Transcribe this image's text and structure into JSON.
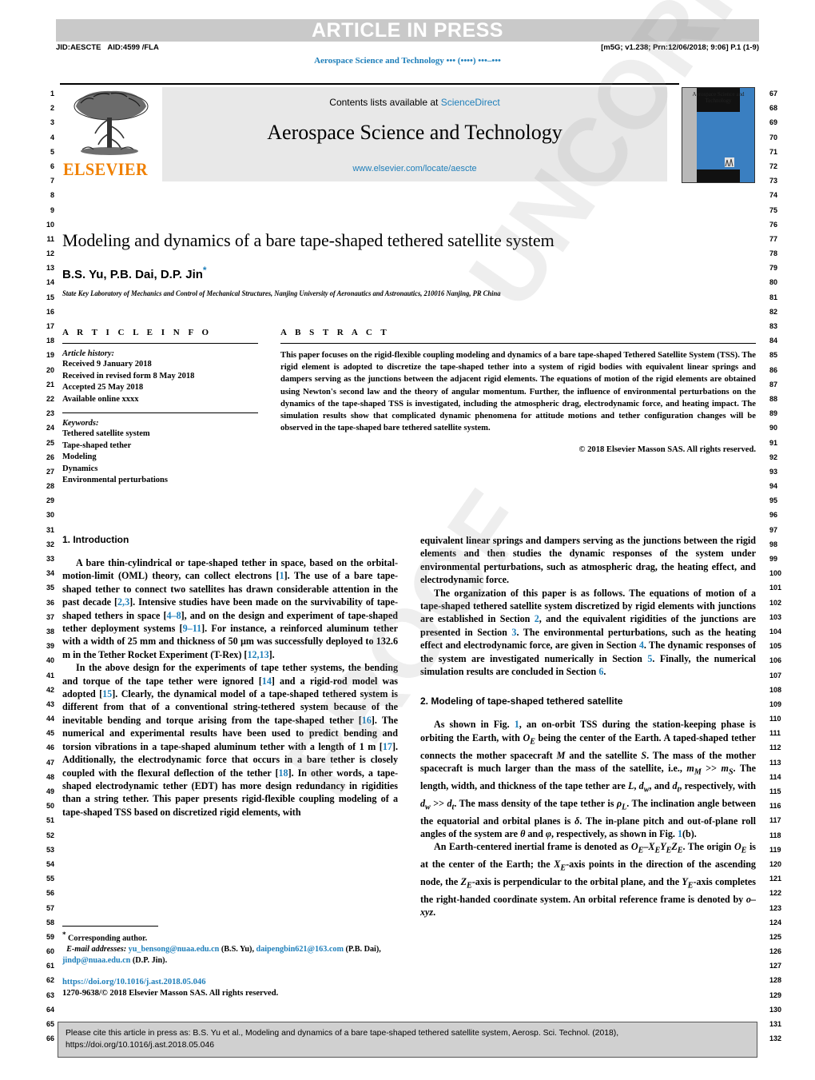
{
  "banner": {
    "article_in_press": "ARTICLE IN PRESS",
    "jid": "JID:AESCTE",
    "aid": "AID:4599 /FLA",
    "production_stamp": "[m5G; v1.238; Prn:12/06/2018; 9:06] P.1 (1-9)",
    "journal_ref": "Aerospace Science and Technology ••• (••••) •••–•••"
  },
  "masthead": {
    "contents_prefix": "Contents lists available at ",
    "sciencedirect": "ScienceDirect",
    "journal_title": "Aerospace Science and Technology",
    "journal_url": "www.elsevier.com/locate/aescte",
    "publisher_wordmark": "ELSEVIER",
    "cover_title": "Aerospace Science and Technology"
  },
  "article": {
    "title": "Modeling and dynamics of a bare tape-shaped tethered satellite system",
    "authors": "B.S. Yu, P.B. Dai, D.P. Jin",
    "corresponding_marker": "*",
    "affiliation": "State Key Laboratory of Mechanics and Control of Mechanical Structures, Nanjing University of Aeronautics and Astronautics, 210016 Nanjing, PR China"
  },
  "article_info": {
    "heading": "A R T I C L E   I N F O",
    "history_label": "Article history:",
    "history": [
      "Received 9 January 2018",
      "Received in revised form 8 May 2018",
      "Accepted 25 May 2018",
      "Available online xxxx"
    ],
    "keywords_label": "Keywords:",
    "keywords": [
      "Tethered satellite system",
      "Tape-shaped tether",
      "Modeling",
      "Dynamics",
      "Environmental perturbations"
    ]
  },
  "abstract": {
    "heading": "A B S T R A C T",
    "text": "This paper focuses on the rigid-flexible coupling modeling and dynamics of a bare tape-shaped Tethered Satellite System (TSS). The rigid element is adopted to discretize the tape-shaped tether into a system of rigid bodies with equivalent linear springs and dampers serving as the junctions between the adjacent rigid elements. The equations of motion of the rigid elements are obtained using Newton's second law and the theory of angular momentum. Further, the influence of environmental perturbations on the dynamics of the tape-shaped TSS is investigated, including the atmospheric drag, electrodynamic force, and heating impact. The simulation results show that complicated dynamic phenomena for attitude motions and tether configuration changes will be observed in the tape-shaped bare tethered satellite system.",
    "copyright": "© 2018 Elsevier Masson SAS. All rights reserved."
  },
  "sections": {
    "intro_title": "1. Introduction",
    "intro_p1_parts": {
      "a": "A bare thin-cylindrical or tape-shaped tether in space, based on the orbital-motion-limit (OML) theory, can collect electrons [",
      "r1": "1",
      "b": "]. The use of a bare tape-shaped tether to connect two satellites has drawn considerable attention in the past decade [",
      "r2": "2,3",
      "c": "]. Intensive studies have been made on the survivability of tape-shaped tethers in space [",
      "r3": "4–8",
      "d": "], and on the design and experiment of tape-shaped tether deployment systems [",
      "r4": "9–11",
      "e": "]. For instance, a reinforced aluminum tether with a width of 25 mm and thickness of 50 µm was successfully deployed to 132.6 m in the Tether Rocket Experiment (T-Rex) [",
      "r5": "12,13",
      "f": "]."
    },
    "intro_p2_parts": {
      "a": "In the above design for the experiments of tape tether systems, the bending and torque of the tape tether were ignored [",
      "r1": "14",
      "b": "] and a rigid-rod model was adopted [",
      "r2": "15",
      "c": "]. Clearly, the dynamical model of a tape-shaped tethered system is different from that of a conventional string-tethered system because of the inevitable bending and torque arising from the tape-shaped tether [",
      "r3": "16",
      "d": "]. The numerical and experimental results have been used to predict bending and torsion vibrations in a tape-shaped aluminum tether with a length of 1 m [",
      "r4": "17",
      "e": "]. Additionally, the electrodynamic force that occurs in a bare tether is closely coupled with the flexural deflection of the tether [",
      "r5": "18",
      "f": "]. In other words, a tape-shaped electrodynamic tether (EDT) has more design redundancy in rigidities than a string tether. This paper presents rigid-flexible coupling modeling of a tape-shaped TSS based on discretized rigid elements, with equivalent linear springs and dampers serving as the junctions between the rigid elements and then studies the dynamic responses of the system under environmental perturbations, such as atmospheric drag, the heating effect, and electrodynamic force."
    },
    "intro_p3_parts": {
      "a": "The organization of this paper is as follows. The equations of motion of a tape-shaped tethered satellite system discretized by rigid elements with junctions are established in Section ",
      "r1": "2",
      "b": ", and the equivalent rigidities of the junctions are presented in Section ",
      "r2": "3",
      "c": ". The environmental perturbations, such as the heating effect and electrodynamic force, are given in Section ",
      "r3": "4",
      "d": ". The dynamic responses of the system are investigated numerically in Section ",
      "r4": "5",
      "e": ". Finally, the numerical simulation results are concluded in Section ",
      "r5": "6",
      "f": "."
    },
    "sec2_title": "2. Modeling of tape-shaped tethered satellite",
    "sec2_p1_parts": {
      "a": "As shown in Fig. ",
      "r1": "1",
      "b": ", an on-orbit TSS during the station-keeping phase is orbiting the Earth, with ",
      "i1": "O",
      "s1": "E",
      "c": " being the center of the Earth. A taped-shaped tether connects the mother spacecraft ",
      "i2": "M",
      "d": " and the satellite ",
      "i3": "S",
      "e": ". The mass of the mother spacecraft is much larger than the mass of the satellite, i.e., ",
      "i4": "m",
      "s2": "M",
      "f": " >> ",
      "i5": "m",
      "s3": "S",
      "g": ". The length, width, and thickness of the tape tether are ",
      "i6": "L",
      "h": ", ",
      "i7": "d",
      "s4": "w",
      "i8": ", and ",
      "i9": "d",
      "s5": "t",
      "j": ", respectively, with ",
      "i10": "d",
      "s6": "w",
      "k": " >> ",
      "i11": "d",
      "s7": "t",
      "l": ". The mass density of the tape tether is ",
      "i12": "ρ",
      "s8": "L",
      "m": ". The inclination angle between the equatorial and orbital planes is ",
      "i13": "δ",
      "n": ". The in-plane pitch and out-of-plane roll angles of the system are ",
      "i14": "θ",
      "o": " and ",
      "i15": "φ",
      "p": ", respectively, as shown in Fig. ",
      "r2": "1",
      "q": "(b)."
    },
    "sec2_p2_parts": {
      "a": "An Earth-centered inertial frame is denoted as ",
      "i1": "O",
      "s1": "E",
      "b": "–",
      "i2": "X",
      "s2": "E",
      "i3": "Y",
      "s3": "E",
      "i4": "Z",
      "s4": "E",
      "c": ". The origin ",
      "i5": "O",
      "s5": "E",
      "d": " is at the center of the Earth; the ",
      "i6": "X",
      "s6": "E",
      "e": "-axis points in the direction of the ascending node, the ",
      "i7": "Z",
      "s7": "E",
      "f": "-axis is perpendicular to the orbital plane, and the ",
      "i8": "Y",
      "s8": "E",
      "g": "-axis completes the right-handed coordinate system. An orbital reference frame is denoted by ",
      "i9": "o–xyz",
      "h": "."
    }
  },
  "footnote": {
    "corresponding": "Corresponding author.",
    "email_label": "E-mail addresses:",
    "email1": "yu_bensong@nuaa.edu.cn",
    "email1_owner": "(B.S. Yu)",
    "email2": "daipengbin621@163.com",
    "email2_owner": "(P.B. Dai)",
    "email3": "jindp@nuaa.edu.cn",
    "email3_owner": "(D.P. Jin)",
    "doi": "https://doi.org/10.1016/j.ast.2018.05.046",
    "issn_copyright": "1270-9638/© 2018 Elsevier Masson SAS. All rights reserved."
  },
  "cite_box": {
    "line1": "Please cite this article in press as: B.S. Yu et al., Modeling and dynamics of a bare tape-shaped tethered satellite system, Aerosp. Sci. Technol. (2018),",
    "line2": "https://doi.org/10.1016/j.ast.2018.05.046"
  },
  "watermark": {
    "text1": "UNCORRECTED",
    "text2": "PROOF"
  },
  "line_numbers": {
    "left_start": 1,
    "left_end": 66,
    "right_start": 67,
    "right_end": 132
  },
  "colors": {
    "link": "#1f7fba",
    "elsevier_orange": "#f08000",
    "banner_gray": "#c9c9c9",
    "masthead_gray": "#e8e8e8",
    "cite_box_gray": "#d0d0d0"
  }
}
